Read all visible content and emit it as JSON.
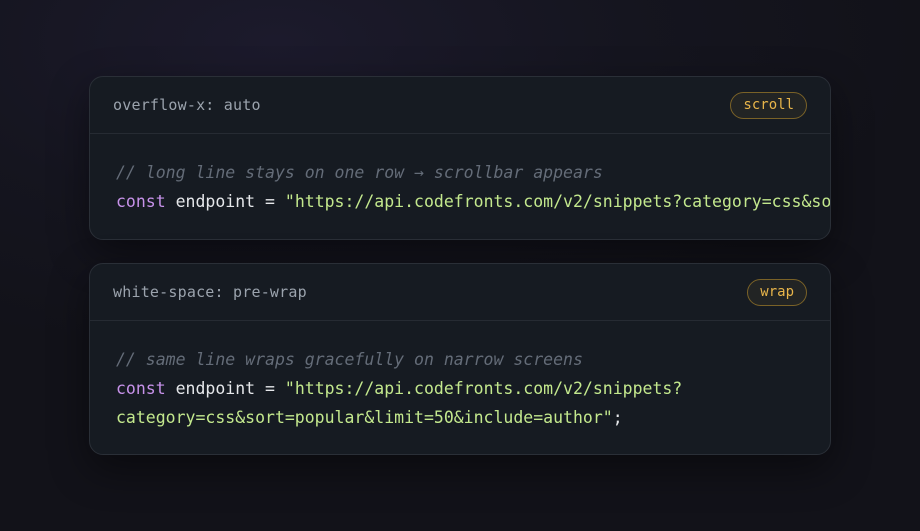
{
  "cards": [
    {
      "title": "overflow-x: auto",
      "badge": "scroll",
      "comment": "// long line stays on one row → scrollbar appears",
      "keyword": "const",
      "identifier": " endpoint = ",
      "string": "\"https://api.codefronts.com/v2/snippets?category=css&so"
    },
    {
      "title": "white-space: pre-wrap",
      "badge": "wrap",
      "comment": "// same line wraps gracefully on narrow screens",
      "keyword": "const",
      "identifier": " endpoint = ",
      "string": "\"https://api.codefronts.com/v2/snippets? category=css&sort=popular&limit=50&include=author\"",
      "terminator": ";"
    }
  ],
  "colors": {
    "keyword": "#c792ea",
    "string": "#c3e88d",
    "comment": "#646c78",
    "badge": "#e8b54a"
  }
}
